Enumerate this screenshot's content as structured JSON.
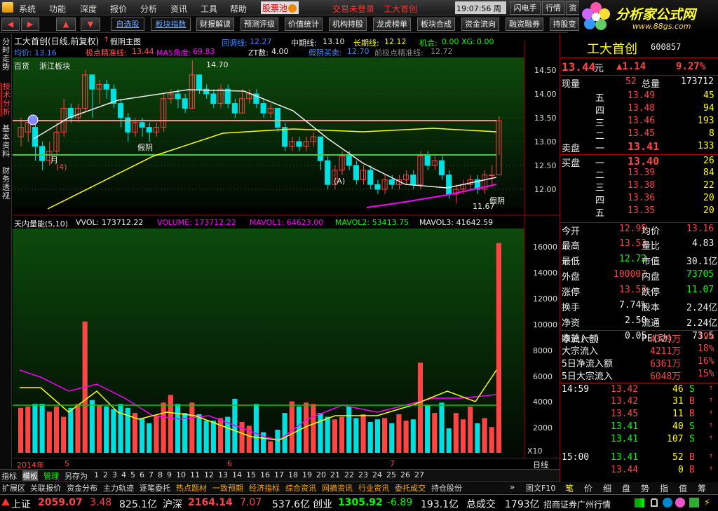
{
  "menubar": {
    "items": [
      "系统",
      "功能",
      "深度",
      "报价",
      "分析",
      "资讯",
      "工具",
      "帮助"
    ],
    "stock_pool": "股票池",
    "login": "交易未登录",
    "stock_title": "工大首创",
    "time": "19:07:56",
    "weekday": "周日",
    "flash": "闪电手",
    "quote": "行情",
    "cut": "资",
    "logo_text": "分析家公式网",
    "logo_url": "www.88gs.com"
  },
  "toolbar": {
    "self_select": "自选股",
    "block_index": "板块指数",
    "buttons": [
      "财报解读",
      "预测评级",
      "价值统计",
      "机构持股",
      "龙虎榜单",
      "板块合成",
      "资金流向",
      "融资融券",
      "持股变"
    ]
  },
  "lefttabs": [
    "分时走势",
    "技术分析",
    "基本资料",
    "财务透视"
  ],
  "chart": {
    "title": "工大首创(日线,前复权)",
    "main_formula": "假阴主图",
    "line2": {
      "lbl1": "回调线:",
      "v1": "12.27",
      "lbl2": "中期线:",
      "v2": "13.10",
      "lbl3": "长期线:",
      "v3": "12.12",
      "lbl4": "机会:",
      "v4": "0.00",
      "lbl5": "XG:",
      "v5": "0.00"
    },
    "line3": {
      "a": "均价: 13.16",
      "b": "极点精准线:",
      "bv": "13.44",
      "c": "MA5角度:",
      "cv": "69.83",
      "d": "ZT数:",
      "dv": "4.00",
      "e": "假阴买卖:",
      "ev": "12.70",
      "f": "前极点精准线:",
      "fv": "12.72"
    },
    "tags": [
      "百货",
      "浙江板块"
    ],
    "annotations": {
      "high": "14.70",
      "low": "11.67",
      "fake1": "假阴",
      "fake2": "假阴",
      "mark1": "(4)",
      "mark2": "(A)",
      "month": "月"
    },
    "price_axis": [
      "14.50",
      "14.00",
      "13.50",
      "13.00",
      "12.50",
      "12.00"
    ],
    "vol_header": {
      "name": "天内量能(5,10)",
      "vvol": "VVOL: 173712.22",
      "volume": "VOLUME: 173712.22",
      "mavol1": "MAVOL1: 64623.00",
      "mavol2": "MAVOL2: 53413.75",
      "mavol3": "MAVOL3: 41642.59"
    },
    "vol_axis": [
      "16000",
      "14000",
      "12000",
      "10000",
      "8000",
      "6000",
      "4000",
      "2000"
    ],
    "x10": "X10",
    "date_axis": {
      "year": "2014年",
      "m5": "5",
      "m6": "6",
      "m7": "7"
    },
    "period": "日线"
  },
  "bottomtabs": {
    "items": [
      "指标",
      "模板",
      "管理",
      "另存为",
      "1",
      "2",
      "3",
      "4",
      "5",
      "6",
      "7",
      "8",
      "9",
      "10",
      "11",
      "12",
      "13",
      "14",
      "15",
      "16",
      "17",
      "18",
      "19",
      "20",
      "21",
      "22",
      "23",
      "24",
      "25",
      "26",
      "27"
    ]
  },
  "bottomtabs2": {
    "items": [
      "扩展区",
      "关联报价",
      "资金分布",
      "主力轨迹",
      "逐笔委托",
      "热点题材",
      "一致预期",
      "经济指标",
      "综合资讯",
      "网摘资讯",
      "行业资讯",
      "委托成交",
      "持仓股份"
    ],
    "extra": "图文F10",
    "right": [
      "笔",
      "价",
      "细",
      "盘",
      "势",
      "指",
      "值",
      "筹"
    ]
  },
  "quote": {
    "name": "工大首创",
    "code": "600857",
    "price": "13.44",
    "unit": "元",
    "change": "▲1.14",
    "pct": "9.27%",
    "now_lbl": "现量",
    "now": "52",
    "total_lbl": "总量",
    "total": "173712",
    "sell": [
      [
        "五",
        "13.49",
        "45"
      ],
      [
        "四",
        "13.48",
        "94"
      ],
      [
        "三",
        "13.46",
        "193"
      ],
      [
        "二",
        "13.45",
        "8"
      ],
      [
        "一",
        "13.41",
        "133"
      ]
    ],
    "sell_lbl": "卖盘",
    "buy_lbl": "买盘",
    "buy": [
      [
        "一",
        "13.40",
        "26"
      ],
      [
        "二",
        "13.39",
        "84"
      ],
      [
        "三",
        "13.38",
        "22"
      ],
      [
        "四",
        "13.36",
        "20"
      ],
      [
        "五",
        "13.35",
        "20"
      ]
    ],
    "stats": [
      [
        "今开",
        "12.95",
        "均价",
        "13.16"
      ],
      [
        "最高",
        "13.53",
        "量比",
        "4.83"
      ],
      [
        "最低",
        "12.72",
        "市值",
        "30.1亿"
      ],
      [
        "外盘",
        "100007",
        "内盘",
        "73705"
      ],
      [
        "涨停",
        "13.53",
        "跌停",
        "11.07"
      ],
      [
        "换手",
        "7.74%",
        "股本",
        "2.24亿"
      ],
      [
        "净资",
        "2.50",
        "流通",
        "2.24亿"
      ],
      [
        "收益(一)",
        "0.05",
        "PE(动)",
        "73.5"
      ]
    ],
    "flows": [
      [
        "净流入额",
        "4329万",
        "19%"
      ],
      [
        "大宗流入",
        "4211万",
        "18%"
      ],
      [
        "5日净流入额",
        "6361万",
        "16%"
      ],
      [
        "5日大宗流入",
        "6048万",
        "15%"
      ]
    ],
    "ticks": [
      [
        "14:59",
        "13.42",
        "46",
        "S"
      ],
      [
        "",
        "13.42",
        "31",
        "B"
      ],
      [
        "",
        "13.45",
        "11",
        "B"
      ],
      [
        "",
        "13.41",
        "40",
        "S"
      ],
      [
        "",
        "13.41",
        "107",
        "S"
      ],
      [
        "15:00",
        "13.41",
        "52",
        "B"
      ],
      [
        "",
        "13.44",
        "0",
        "B"
      ]
    ]
  },
  "status": {
    "sh_lbl": "上证",
    "sh": "2059.07",
    "sh_chg": "3.48",
    "sh_amt": "825.1亿",
    "sz_lbl": "沪深",
    "sz": "2164.14",
    "sz_chg": "7.07",
    "sz_amt": "537.6亿",
    "cy_lbl": "创业",
    "cy": "1305.92",
    "cy_chg": "-6.89",
    "cy_amt": "193.1亿",
    "total_lbl": "总成交",
    "total": "1793亿",
    "broker": "招商证券广州行情"
  },
  "colors": {
    "up": "#ff4444",
    "down": "#00e0e0",
    "panel_bg": "#0a3a0a"
  }
}
